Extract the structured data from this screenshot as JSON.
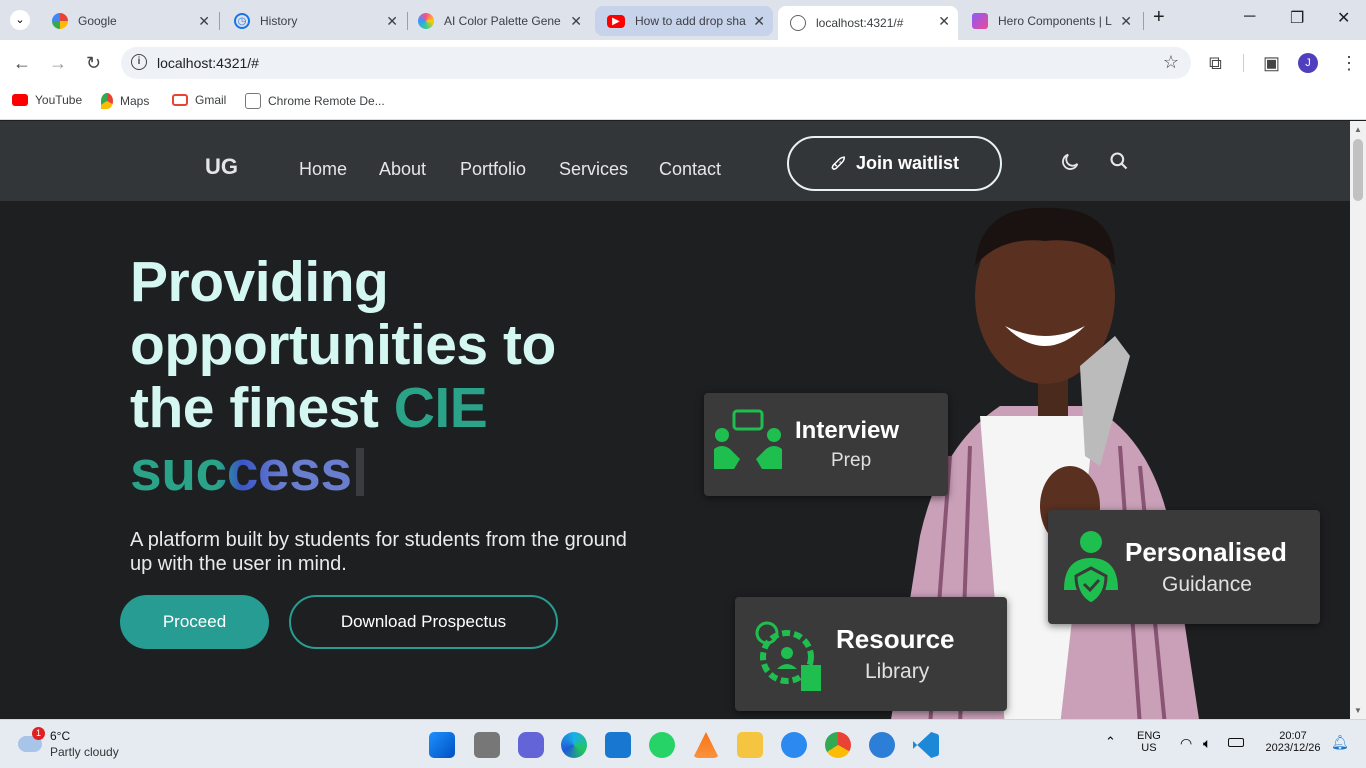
{
  "browser": {
    "tabs": [
      {
        "title": "Google",
        "icon": "google-icon"
      },
      {
        "title": "History",
        "icon": "history-icon"
      },
      {
        "title": "AI Color Palette Gene",
        "icon": "palette-icon"
      },
      {
        "title": "How to add drop sha",
        "icon": "youtube-icon"
      },
      {
        "title": "localhost:4321/#",
        "icon": "globe-icon"
      },
      {
        "title": "Hero Components | L",
        "icon": "hero-icon"
      }
    ],
    "url": "localhost:4321/#",
    "bookmarks": [
      "YouTube",
      "Maps",
      "Gmail",
      "Chrome Remote De..."
    ],
    "profile_initial": "J"
  },
  "site": {
    "logo": "UG",
    "nav": [
      "Home",
      "About",
      "Portfolio",
      "Services",
      "Contact"
    ],
    "join_label": "Join waitlist",
    "headline_1": "Providing",
    "headline_2": "opportunities to",
    "headline_3a": "the finest ",
    "headline_3b": "CIE",
    "headline_4": "success",
    "subtitle": "A platform built by students for students from the ground up with the user in mind.",
    "proceed_label": "Proceed",
    "download_label": "Download Prospectus",
    "cards": {
      "interview": {
        "title": "Interview",
        "sub": "Prep"
      },
      "personalised": {
        "title": "Personalised",
        "sub": "Guidance"
      },
      "resource": {
        "title": "Resource",
        "sub": "Library"
      }
    },
    "colors": {
      "accent": "#279c92",
      "icon_green": "#1fbf4f",
      "headline": "#d4f7f2"
    }
  },
  "taskbar": {
    "weather_temp": "6°C",
    "weather_desc": "Partly cloudy",
    "weather_badge": "1",
    "lang_1": "ENG",
    "lang_2": "US",
    "time": "20:07",
    "date": "2023/12/26"
  }
}
